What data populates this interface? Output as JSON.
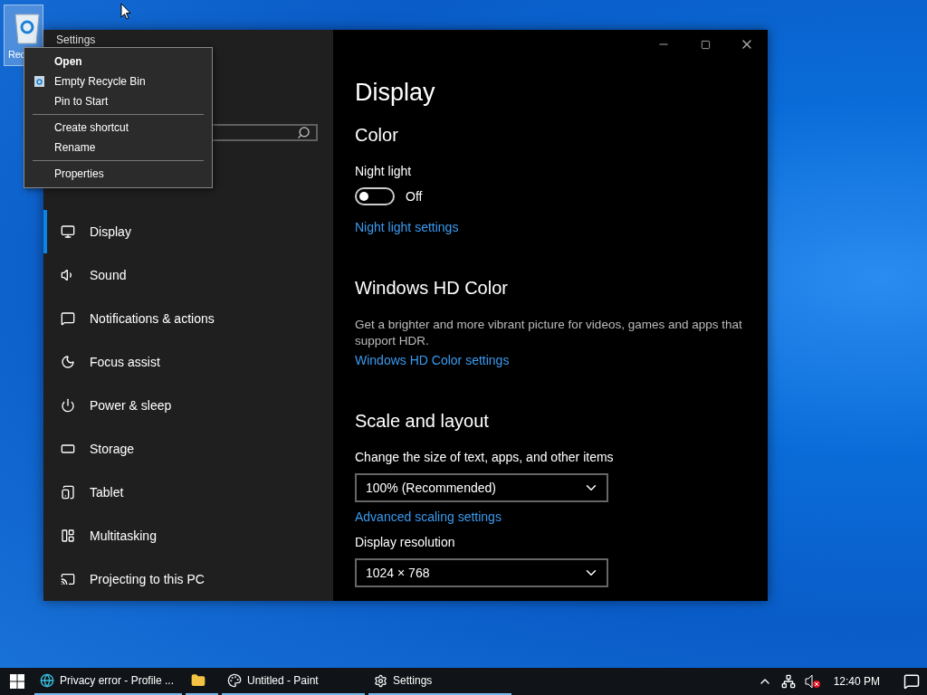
{
  "desktop_icons": [
    {
      "label": "Rec",
      "selected": true
    }
  ],
  "window": {
    "title": "Settings",
    "nav": [
      {
        "label": "Display",
        "selected": true
      },
      {
        "label": "Sound",
        "selected": false
      },
      {
        "label": "Notifications & actions",
        "selected": false
      },
      {
        "label": "Focus assist",
        "selected": false
      },
      {
        "label": "Power & sleep",
        "selected": false
      },
      {
        "label": "Storage",
        "selected": false
      },
      {
        "label": "Tablet",
        "selected": false
      },
      {
        "label": "Multitasking",
        "selected": false
      },
      {
        "label": "Projecting to this PC",
        "selected": false
      }
    ],
    "page_title": "Display",
    "sections": [
      {
        "title": "Color",
        "items": [
          {
            "kind": "label",
            "text": "Night light"
          },
          {
            "kind": "toggle",
            "on": false,
            "text": "Off"
          },
          {
            "kind": "link",
            "text": "Night light settings"
          }
        ]
      },
      {
        "title": "Windows HD Color",
        "items": [
          {
            "kind": "paragraph",
            "text": "Get a brighter and more vibrant picture for videos, games and apps that support HDR."
          },
          {
            "kind": "link",
            "text": "Windows HD Color settings"
          }
        ]
      },
      {
        "title": "Scale and layout",
        "items": [
          {
            "kind": "label",
            "text": "Change the size of text, apps, and other items"
          },
          {
            "kind": "dropdown",
            "value": "100% (Recommended)"
          },
          {
            "kind": "link",
            "text": "Advanced scaling settings"
          },
          {
            "kind": "label",
            "text": "Display resolution"
          },
          {
            "kind": "dropdown",
            "value": "1024 × 768"
          }
        ]
      }
    ]
  },
  "context_menu": {
    "groups": [
      [
        {
          "label": "Open",
          "default": true
        },
        {
          "label": "Empty Recycle Bin",
          "default": false
        },
        {
          "label": "Pin to Start",
          "default": false
        }
      ],
      [
        {
          "label": "Create shortcut",
          "default": false
        },
        {
          "label": "Rename",
          "default": false
        }
      ],
      [
        {
          "label": "Properties",
          "default": false
        }
      ]
    ]
  },
  "taskbar": {
    "apps": [
      {
        "kind": "window",
        "label": "Privacy error - Profile ..."
      },
      {
        "kind": "pinned"
      },
      {
        "kind": "window",
        "label": "Untitled - Paint"
      },
      {
        "kind": "window",
        "label": "Settings"
      }
    ],
    "time": "12:40 PM"
  }
}
